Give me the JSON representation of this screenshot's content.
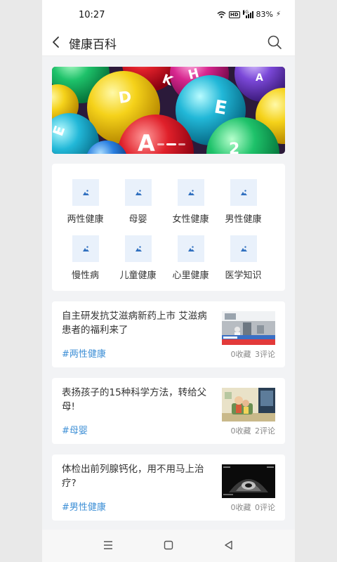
{
  "status_bar": {
    "time": "10:27",
    "battery": "83%",
    "hd": "HD",
    "network": "5G"
  },
  "header": {
    "title": "健康百科"
  },
  "banner": {
    "letters": [
      "D",
      "A",
      "E",
      "E",
      "K",
      "H",
      "A",
      "2"
    ],
    "active_slide": 1,
    "slide_count": 3
  },
  "categories": [
    {
      "label": "两性健康"
    },
    {
      "label": "母婴"
    },
    {
      "label": "女性健康"
    },
    {
      "label": "男性健康"
    },
    {
      "label": "慢性病"
    },
    {
      "label": "儿童健康"
    },
    {
      "label": "心里健康"
    },
    {
      "label": "医学知识"
    }
  ],
  "articles": [
    {
      "title": "自主研发抗艾滋病新药上市 艾滋病患者的福利来了",
      "tag": "#两性健康",
      "favorites": "0收藏",
      "comments": "3评论"
    },
    {
      "title": "表扬孩子的15种科学方法，转给父母!",
      "tag": "#母婴",
      "favorites": "0收藏",
      "comments": "2评论"
    },
    {
      "title": "体检出前列腺钙化，用不用马上治疗?",
      "tag": "#男性健康",
      "favorites": "0收藏",
      "comments": "0评论"
    }
  ],
  "colors": {
    "accent": "#3d8fd6",
    "icon_bg": "#e9f1fb",
    "page_bg": "#f2f3f5"
  }
}
